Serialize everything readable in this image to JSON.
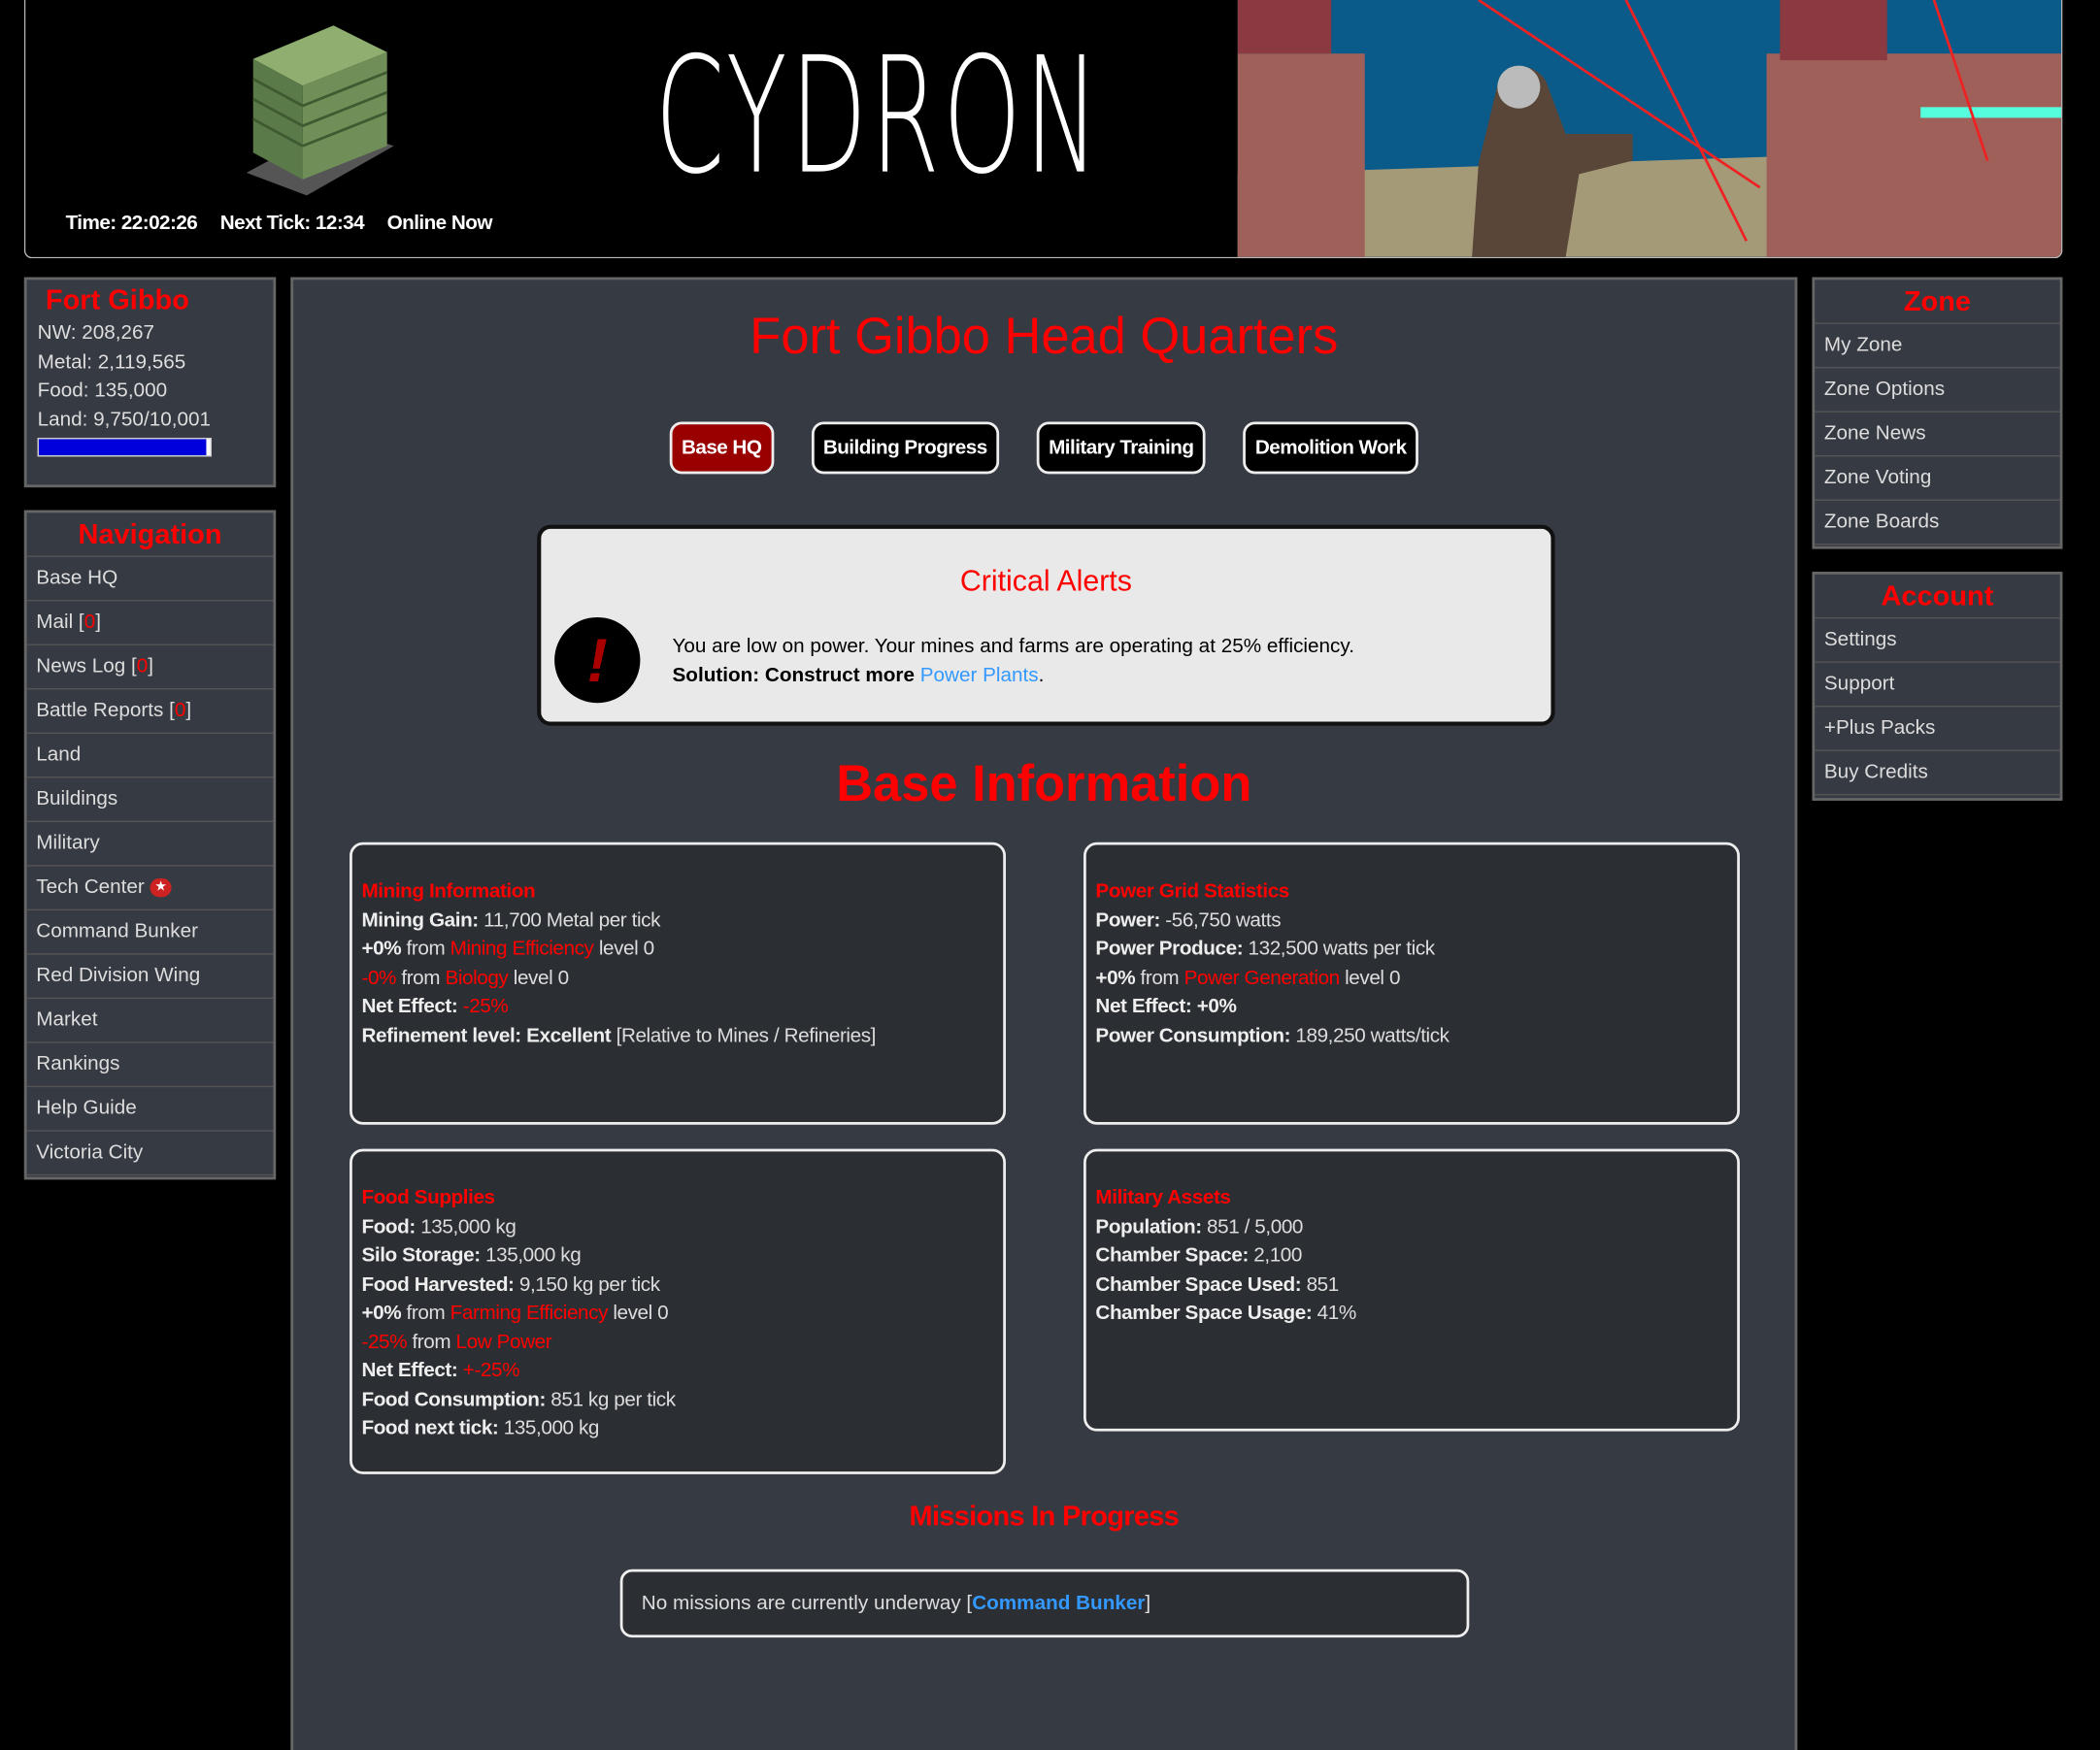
{
  "header": {
    "logo": "CYDRON",
    "time": "Time: 22:02:26",
    "next_tick": "Next Tick: 12:34",
    "online": "Online Now"
  },
  "base": {
    "name": "Fort Gibbo",
    "nw": "NW: 208,267",
    "metal": "Metal: 2,119,565",
    "food": "Food: 135,000",
    "land": "Land: 9,750/10,001",
    "land_fraction": 0.975
  },
  "navigation": {
    "title": "Navigation",
    "items": [
      "Base HQ",
      "Mail [",
      "News Log [",
      "Battle Reports [",
      "Land",
      "Buildings",
      "Military",
      "Tech Center",
      "Command Bunker",
      "Red Division Wing",
      "Market",
      "Rankings",
      "Help Guide",
      "Victoria City"
    ],
    "count": "0",
    "close": "]"
  },
  "main": {
    "title": "Fort Gibbo Head Quarters",
    "tabs": [
      "Base HQ",
      "Building Progress",
      "Military Training",
      "Demolition Work"
    ],
    "alert": {
      "title": "Critical Alerts",
      "message": "You are low on power. Your mines and farms are operating at 25% efficiency.",
      "solution_label": "Solution: Construct more",
      "solution_link": "Power Plants",
      "period": "."
    },
    "section_title": "Base Information",
    "mining": {
      "title": "Mining Information",
      "gain_l": "Mining Gain:",
      "gain_v": " 11,700 Metal per tick",
      "eff_pct": "+0%",
      "from": " from ",
      "eff_name": "Mining Efficiency",
      "eff_lvl": " level 0",
      "bio_pct": "-0%",
      "bio_name": "Biology",
      "bio_lvl": " level 0",
      "net_l": "Net Effect:",
      "net_v": " -25%",
      "ref_l": "Refinement level:",
      "ref_v": " Excellent",
      "ref_note": " [Relative to Mines / Refineries]"
    },
    "power": {
      "title": "Power Grid Statistics",
      "power_l": "Power:",
      "power_v": " -56,750 watts",
      "prod_l": "Power Produce:",
      "prod_v": " 132,500 watts per tick",
      "gen_pct": "+0%",
      "from": " from ",
      "gen_name": "Power Generation",
      "gen_lvl": " level 0",
      "net_l": "Net Effect:",
      "net_v": " +0%",
      "cons_l": "Power Consumption:",
      "cons_v": " 189,250 watts/tick"
    },
    "food": {
      "title": "Food Supplies",
      "food_l": "Food:",
      "food_v": " 135,000 kg",
      "silo_l": "Silo Storage:",
      "silo_v": " 135,000 kg",
      "harv_l": "Food Harvested:",
      "harv_v": " 9,150 kg per tick",
      "farm_pct": "+0%",
      "from": " from ",
      "farm_name": "Farming Efficiency",
      "farm_lvl": " level 0",
      "low_pct": "-25%",
      "low_name": "Low Power",
      "net_l": "Net Effect:",
      "net_v": " +-25%",
      "cons_l": "Food Consumption:",
      "cons_v": " 851 kg per tick",
      "next_l": "Food next tick:",
      "next_v": " 135,000 kg"
    },
    "military": {
      "title": "Military Assets",
      "pop_l": "Population:",
      "pop_v": " 851 / 5,000",
      "ch_l": "Chamber Space:",
      "ch_v": " 2,100",
      "used_l": "Chamber Space Used:",
      "used_v": " 851",
      "usage_l": "Chamber Space Usage:",
      "usage_v": " 41%"
    },
    "missions": {
      "title": "Missions In Progress",
      "text": "No missions are currently underway [",
      "link": "Command Bunker",
      "close": "]"
    }
  },
  "zone": {
    "title": "Zone",
    "items": [
      "My Zone",
      "Zone Options",
      "Zone News",
      "Zone Voting",
      "Zone Boards"
    ]
  },
  "account": {
    "title": "Account",
    "items": [
      "Settings",
      "Support",
      "+Plus Packs",
      "Buy Credits"
    ]
  },
  "colors": {
    "accent": "#ff0000",
    "positive": "#33ff33",
    "link": "#3399ff",
    "panel": "#363a43",
    "active_tab": "#990000",
    "land_bar": "#0000dd"
  },
  "icons": {
    "alert": "exclamation-icon",
    "tech": "star-badge-icon"
  }
}
